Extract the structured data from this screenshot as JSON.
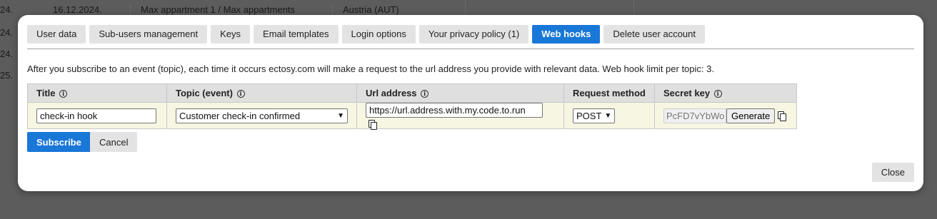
{
  "background": {
    "row": {
      "num": "24.",
      "date": "16.12.2024.",
      "name": "Max appartment 1 / Max appartments",
      "country": "Austria (AUT)"
    },
    "left_numbers": [
      "24.",
      "24.",
      "25."
    ]
  },
  "tabs": [
    {
      "label": "User data",
      "active": false
    },
    {
      "label": "Sub-users management",
      "active": false
    },
    {
      "label": "Keys",
      "active": false
    },
    {
      "label": "Email templates",
      "active": false
    },
    {
      "label": "Login options",
      "active": false
    },
    {
      "label": "Your privacy policy (1)",
      "active": false
    },
    {
      "label": "Web hooks",
      "active": true
    },
    {
      "label": "Delete user account",
      "active": false
    }
  ],
  "intro_text": "After you subscribe to an event (topic), each time it occurs ectosy.com will make a request to the url address you provide with relevant data. Web hook limit per topic: 3.",
  "table": {
    "headers": {
      "title": "Title",
      "topic": "Topic (event)",
      "url": "Url address",
      "method": "Request method",
      "secret": "Secret key"
    },
    "row": {
      "title_value": "check-in hook",
      "topic_value": "Customer check-in confirmed",
      "url_value": "https://url.address.with.my.code.to.run",
      "method_value": "POST",
      "secret_value": "PcFD7vYbWo",
      "generate_label": "Generate"
    }
  },
  "buttons": {
    "subscribe": "Subscribe",
    "cancel": "Cancel",
    "close": "Close"
  },
  "colors": {
    "accent": "#1977d8",
    "row_bg": "#f6f6e2",
    "overlay": "#5c5c5c"
  }
}
